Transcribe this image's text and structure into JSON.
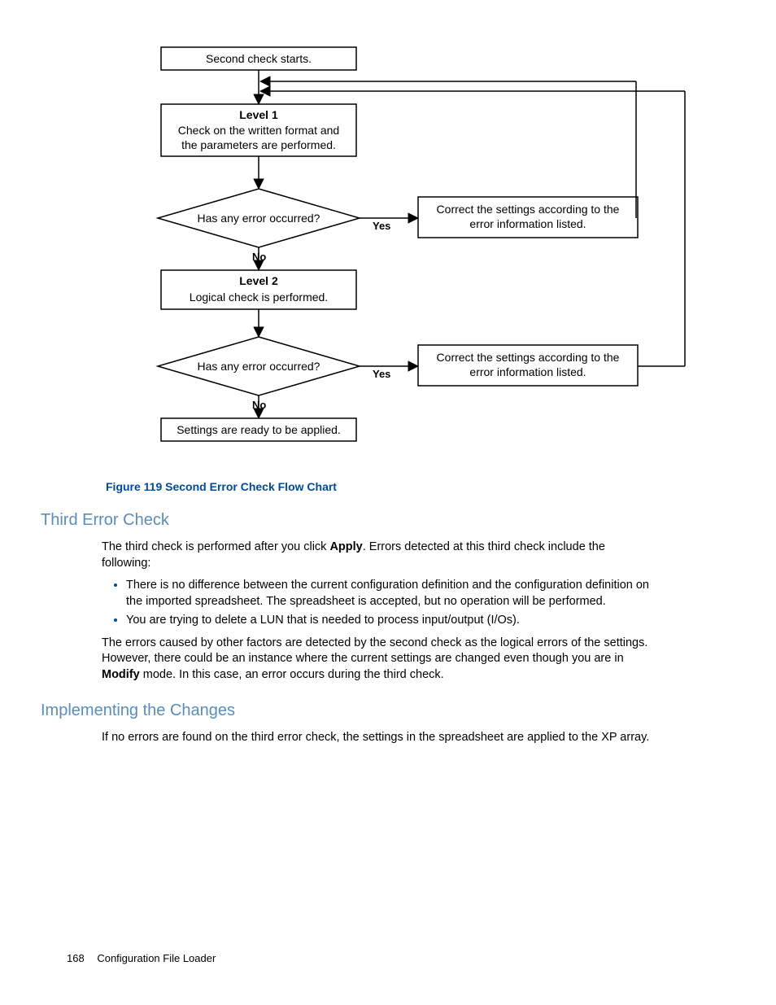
{
  "flowchart": {
    "n1": "Second check starts.",
    "n2_title": "Level 1",
    "n2_body": "Check on the written format and the parameters are performed.",
    "d1": "Has any error occurred?",
    "d1_yes": "Yes",
    "d1_no": "No",
    "c1": "Correct the settings according to the error information listed.",
    "n3_title": "Level 2",
    "n3_body": "Logical check is performed.",
    "d2": "Has any error occurred?",
    "d2_yes": "Yes",
    "d2_no": "No",
    "c2": "Correct the settings according to the error information listed.",
    "n4": "Settings are ready to be applied."
  },
  "figure_caption": "Figure 119 Second Error Check Flow Chart",
  "sections": {
    "third_error_check": {
      "heading": "Third Error Check",
      "p1_a": "The third check is performed after you click ",
      "p1_bold": "Apply",
      "p1_b": ". Errors detected at this third check include the following:",
      "bullets": [
        "There is no difference between the current configuration definition and the configuration definition on the imported spreadsheet. The spreadsheet is accepted, but no operation will be performed.",
        "You are trying to delete a LUN that is needed to process input/output (I/Os)."
      ],
      "p2_a": "The errors caused by other factors are detected by the second check as the logical errors of the settings. However, there could be an instance where the current settings are changed even though you are in ",
      "p2_bold": "Modify",
      "p2_b": " mode. In this case, an error occurs during the third check."
    },
    "implementing": {
      "heading": "Implementing the Changes",
      "p1": "If no errors are found on the third error check, the settings in the spreadsheet are applied to the XP array."
    }
  },
  "footer": {
    "page": "168",
    "title": "Configuration File Loader"
  }
}
